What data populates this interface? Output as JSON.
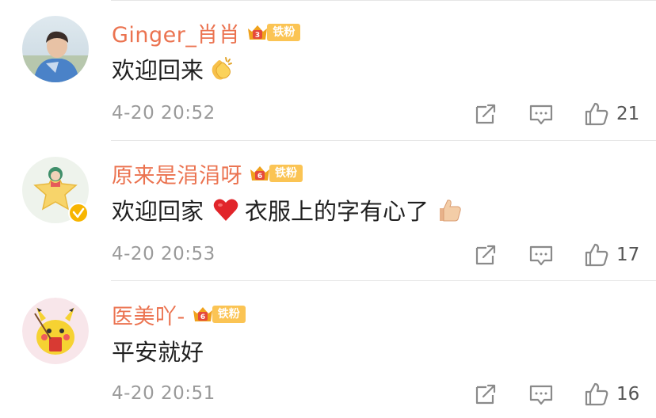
{
  "comments": [
    {
      "username": "Ginger_肖肖",
      "fan_badge": {
        "level": "3",
        "label": "铁粉"
      },
      "text": "欢迎回来",
      "emojis": [
        "clapping-hands"
      ],
      "time": "4-20 20:52",
      "likes": "21",
      "verified": false
    },
    {
      "username": "原来是涓涓呀",
      "fan_badge": {
        "level": "6",
        "label": "铁粉"
      },
      "text_before": "欢迎回家",
      "text_after": "衣服上的字有心了",
      "emojis": [
        "red-heart",
        "thumbs-up"
      ],
      "time": "4-20 20:53",
      "likes": "17",
      "verified": true
    },
    {
      "username": "医美吖-",
      "fan_badge": {
        "level": "6",
        "label": "铁粉"
      },
      "text": "平安就好",
      "emojis": [],
      "time": "4-20 20:51",
      "likes": "16",
      "verified": false
    }
  ],
  "colors": {
    "username": "#eb7350",
    "badge": "#fbc454",
    "meta": "#9a9a9a",
    "icon": "#8a8a8a"
  },
  "icons": [
    "repost-icon",
    "comment-icon",
    "like-icon"
  ]
}
